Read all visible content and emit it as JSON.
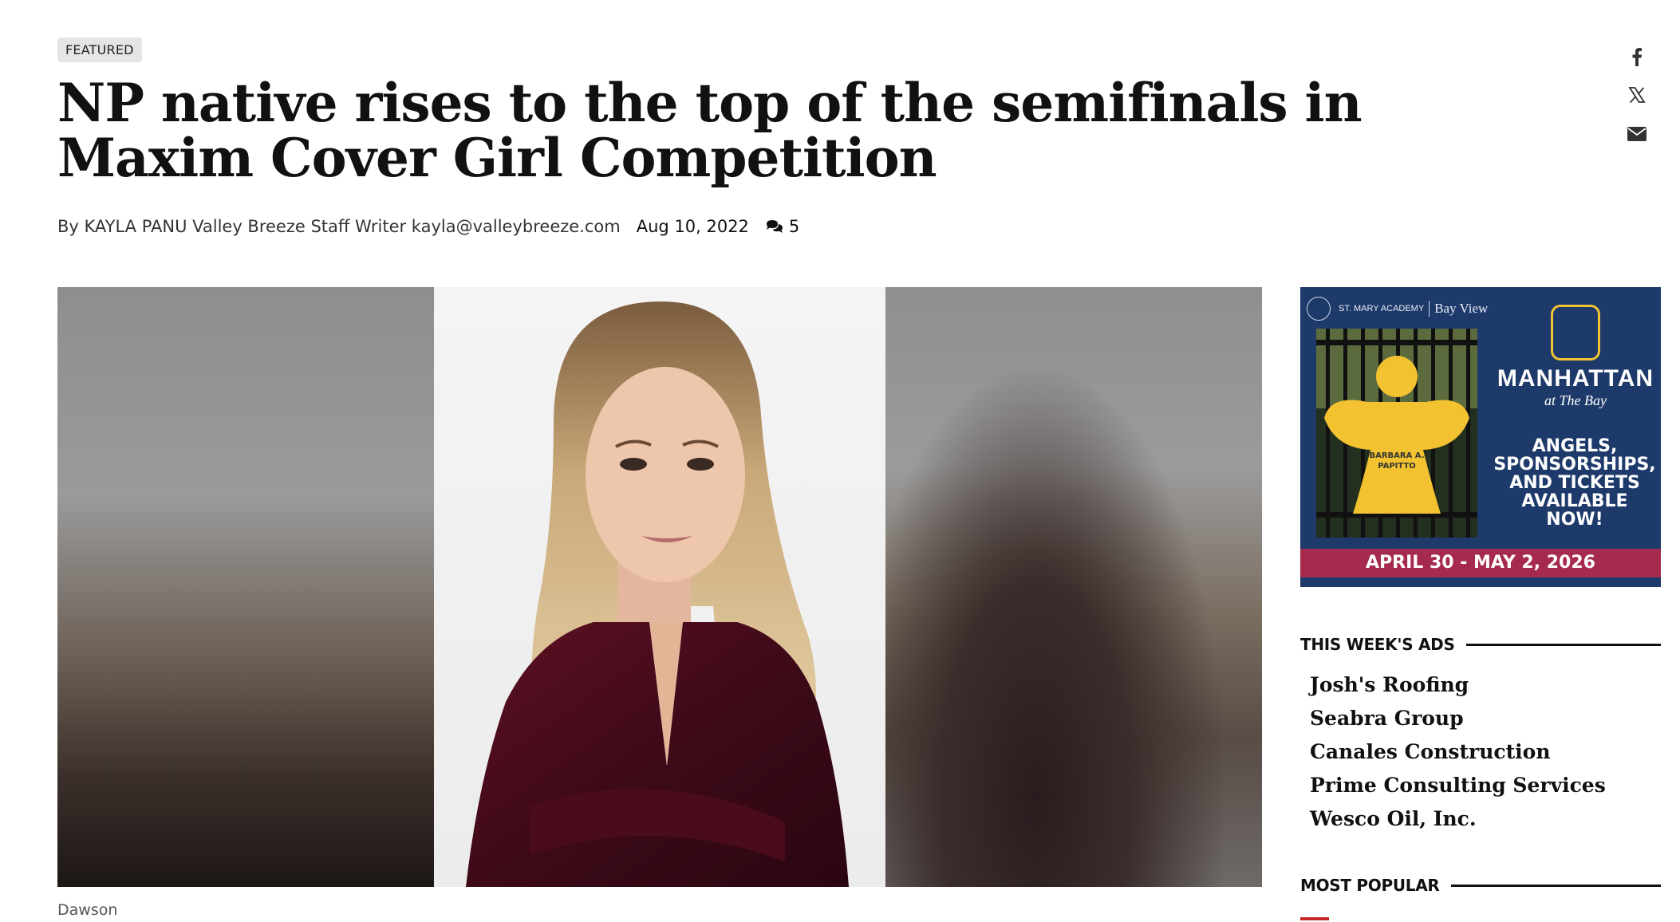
{
  "article": {
    "badge": "FEATURED",
    "headline": "NP native rises to the top of the semifinals in Maxim Cover Girl Competition",
    "byline": "By KAYLA PANU Valley Breeze Staff Writer kayla@valleybreeze.com",
    "date": "Aug 10, 2022",
    "comment_count": "5",
    "caption": "Dawson"
  },
  "share": {
    "icons": [
      "facebook-icon",
      "x-icon",
      "envelope-icon"
    ]
  },
  "ad": {
    "org": "ST. MARY ACADEMY",
    "campus": "Bay View",
    "brand": "MANHATTAN",
    "brand_sub": "at The Bay",
    "angel_name_1": "BARBARA A.",
    "angel_name_2": "PAPITTO",
    "cta_1": "ANGELS,",
    "cta_2": "SPONSORSHIPS,",
    "cta_3": "AND TICKETS",
    "cta_4": "AVAILABLE",
    "cta_5": "NOW!",
    "dates": "APRIL 30 - MAY 2, 2026",
    "colors": {
      "background": "#1e3a6b",
      "accent": "#f1c232",
      "band": "#a52a4e"
    }
  },
  "sidebar": {
    "weeks_ads_title": "THIS WEEK'S ADS",
    "weeks_ads": [
      "Josh's Roofing",
      "Seabra Group",
      "Canales Construction",
      "Prime Consulting Services",
      "Wesco Oil, Inc."
    ],
    "most_popular_title": "MOST POPULAR"
  }
}
